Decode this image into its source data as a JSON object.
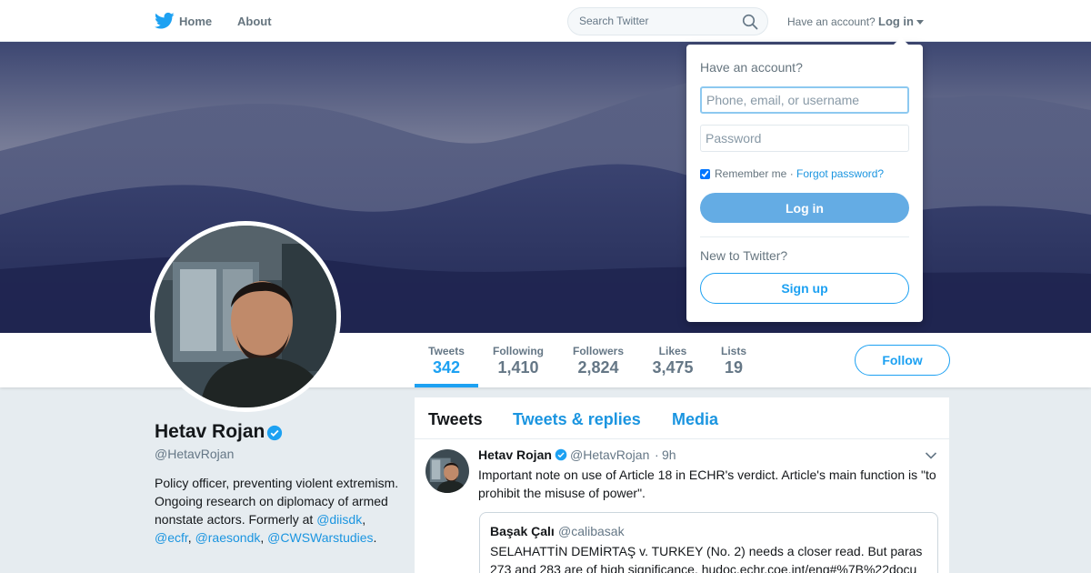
{
  "nav": {
    "home_label": "Home",
    "about_label": "About",
    "search_placeholder": "Search Twitter",
    "have_account": "Have an account?",
    "login_label": "Log in"
  },
  "login_dropdown": {
    "title": "Have an account?",
    "username_placeholder": "Phone, email, or username",
    "password_placeholder": "Password",
    "remember_me": "Remember me",
    "separator": "·",
    "forgot_password": "Forgot password?",
    "login_button": "Log in",
    "new_to_twitter": "New to Twitter?",
    "signup_button": "Sign up"
  },
  "profile": {
    "name": "Hetav Rojan",
    "handle": "@HetavRojan",
    "bio_text": "Policy officer, preventing violent extremism. Ongoing research on diplomacy of armed nonstate actors. Formerly at ",
    "bio_links": [
      "@diisdk",
      "@ecfr",
      "@raesondk",
      "@CWSWarstudies"
    ],
    "bio_sep_1": ", ",
    "bio_sep_2": ", ",
    "bio_sep_3": ",",
    "bio_end": ".",
    "follow_button": "Follow"
  },
  "stats": [
    {
      "label": "Tweets",
      "value": "342"
    },
    {
      "label": "Following",
      "value": "1,410"
    },
    {
      "label": "Followers",
      "value": "2,824"
    },
    {
      "label": "Likes",
      "value": "3,475"
    },
    {
      "label": "Lists",
      "value": "19"
    }
  ],
  "timeline": {
    "tabs": [
      "Tweets",
      "Tweets & replies",
      "Media"
    ],
    "tweet": {
      "name": "Hetav Rojan",
      "handle": "@HetavRojan",
      "dot": "·",
      "time": "9h",
      "text": "Important note on use of Article 18 in ECHR's verdict. Article's main function is \"to prohibit the misuse of power\".",
      "quote": {
        "name": "Başak Çalı",
        "handle": "@calibasak",
        "text": "SELAHATTİN DEMİRTAŞ v. TURKEY (No. 2) needs a closer read. But paras 273 and 283 are of high significance.  hudoc.echr.coe.int/eng#%7B%22docu"
      }
    }
  },
  "colors": {
    "accent": "#1da1f2",
    "link": "#1b95e0",
    "login_button": "#64ace4",
    "background": "#e6ecf0"
  },
  "icons": [
    "twitter-bird-icon",
    "search-icon",
    "chevron-down-icon",
    "verified-icon"
  ]
}
